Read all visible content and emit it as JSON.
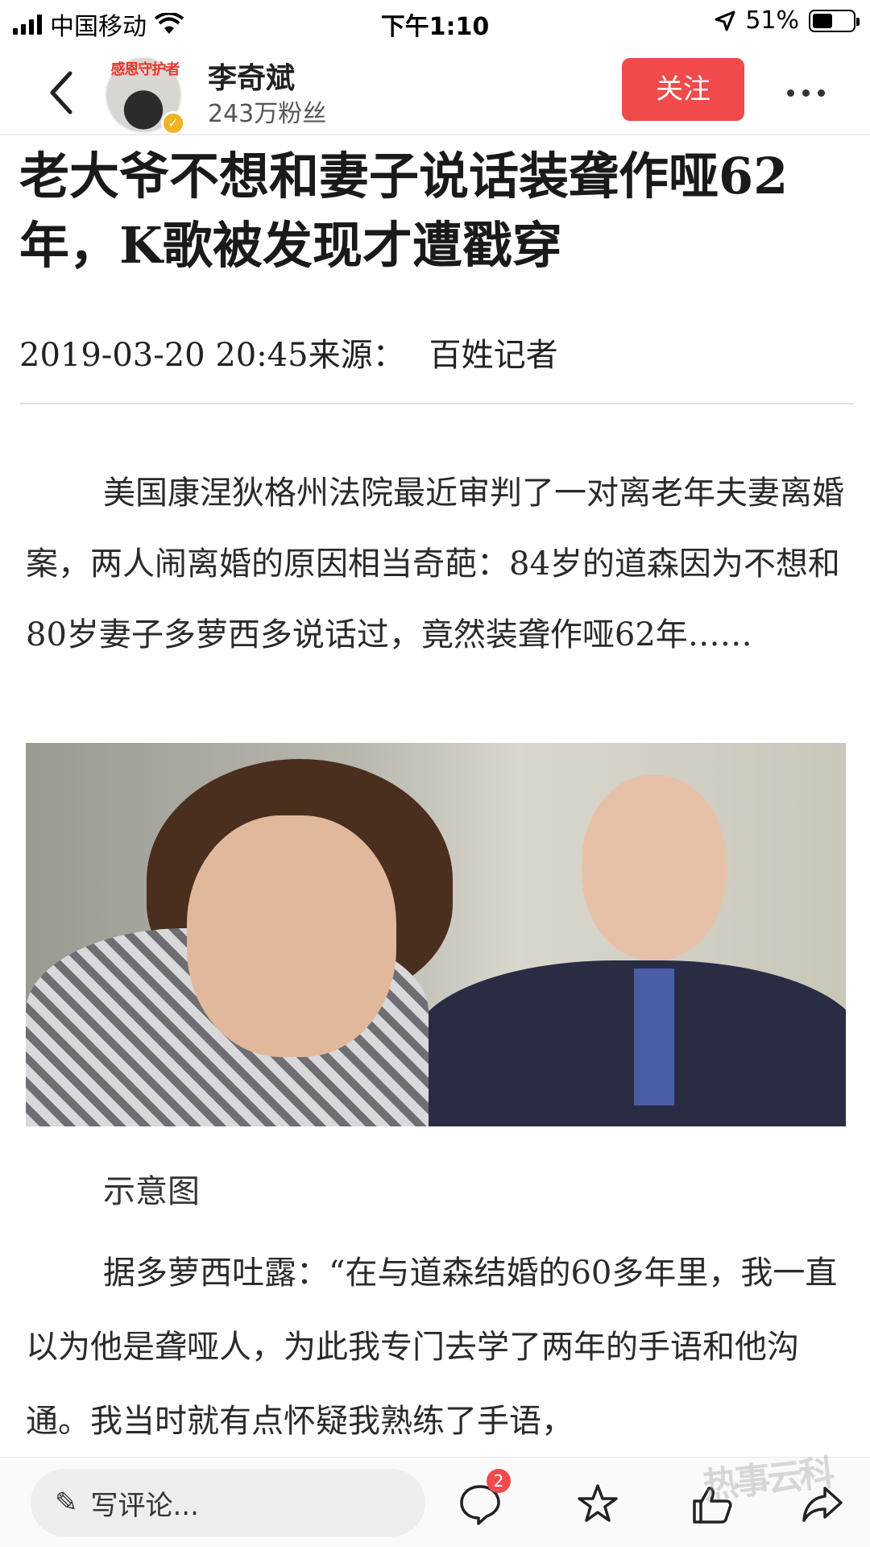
{
  "status_bar": {
    "carrier": "中国移动",
    "time": "下午1:10",
    "battery": "51%",
    "battery_level": 0.51
  },
  "header": {
    "author_name": "李奇斌",
    "fans": "243万粉丝",
    "avatar_ribbon": "感恩守护者",
    "follow_label": "关注"
  },
  "article": {
    "title": "老大爷不想和妻子说话装聋作哑62年，K歌被发现才遭戳穿",
    "date": "2019-03-20 20:45",
    "source_label": "来源：",
    "source": "百姓记者",
    "paragraph1": "美国康涅狄格州法院最近审判了一对离老年夫妻离婚案，两人闹离婚的原因相当奇葩：84岁的道森因为不想和80岁妻子多萝西多说话过，竟然装聋作哑62年……",
    "image_caption": "示意图",
    "paragraph2": "据多萝西吐露：“在与道森结婚的60多年里，我一直以为他是聋哑人，为此我专门去学了两年的手语和他沟通。我当时就有点怀疑我熟练了手语，"
  },
  "bottom_bar": {
    "comment_placeholder": "写评论...",
    "comment_count": "2"
  },
  "watermark": "热事云科",
  "icons": [
    "back-icon",
    "more-icon",
    "pen-icon",
    "comment-icon",
    "star-icon",
    "thumbs-up-icon",
    "share-icon",
    "wifi-icon",
    "location-icon",
    "battery-icon"
  ]
}
